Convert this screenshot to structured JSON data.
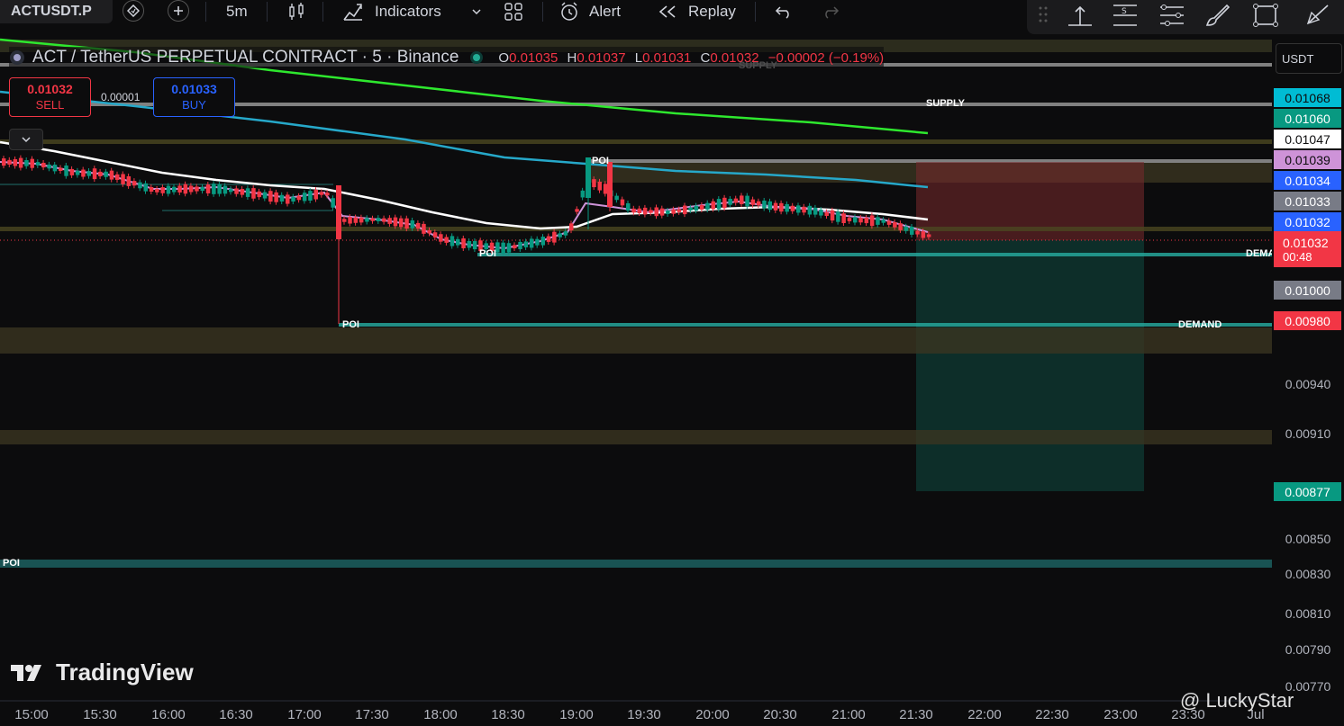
{
  "toolbar": {
    "symbol": "ACTUSDT.P",
    "interval": "5m",
    "indicators_label": "Indicators",
    "alert_label": "Alert",
    "replay_label": "Replay"
  },
  "legend": {
    "title": "ACT / TetherUS PERPETUAL CONTRACT · 5 · Binance",
    "o_label": "O",
    "o_value": "0.01035",
    "h_label": "H",
    "h_value": "0.01037",
    "l_label": "L",
    "l_value": "0.01031",
    "c_label": "C",
    "c_value": "0.01032",
    "change": "−0.00002 (−0.19%)"
  },
  "trade": {
    "sell_price": "0.01032",
    "sell_label": "SELL",
    "buy_price": "0.01033",
    "buy_label": "BUY",
    "spread": "0.00001"
  },
  "axis": {
    "currency": "USDT",
    "price_ticks": [
      "0.00940",
      "0.00910",
      "0.00850",
      "0.00830",
      "0.00810",
      "0.00790",
      "0.00770"
    ],
    "labels": [
      {
        "text": "0.01068",
        "bg": "#00bcd4",
        "fg": "#0c0c0d"
      },
      {
        "text": "0.01060",
        "bg": "#089981",
        "fg": "#ffffff"
      },
      {
        "text": "0.01047",
        "bg": "#ffffff",
        "fg": "#0c0c0d"
      },
      {
        "text": "0.01039",
        "bg": "#ce93d8",
        "fg": "#0c0c0d"
      },
      {
        "text": "0.01034",
        "bg": "#2962ff",
        "fg": "#ffffff"
      },
      {
        "text": "0.01033",
        "bg": "#787b86",
        "fg": "#ffffff"
      },
      {
        "text": "0.01032",
        "bg": "#2962ff",
        "fg": "#ffffff"
      },
      {
        "text": "0.01032",
        "bg": "#f23645",
        "fg": "#ffffff"
      },
      {
        "text": "0.01000",
        "bg": "#787b86",
        "fg": "#ffffff"
      },
      {
        "text": "0.00980",
        "bg": "#f23645",
        "fg": "#ffffff"
      },
      {
        "text": "0.00877",
        "bg": "#089981",
        "fg": "#ffffff"
      }
    ],
    "countdown": "00:48",
    "time_ticks": [
      "15:00",
      "15:30",
      "16:00",
      "16:30",
      "17:00",
      "17:30",
      "18:00",
      "18:30",
      "19:00",
      "19:30",
      "20:00",
      "20:30",
      "21:00",
      "21:30",
      "22:00",
      "22:30",
      "23:00",
      "23:30",
      "Jul"
    ]
  },
  "zones": {
    "supply_1": "SUPPLY",
    "supply_2": "SUPPLY",
    "demand_1": "DEMAND",
    "demand_2": "DEMA",
    "poi_1": "POI",
    "poi_2": "POI",
    "poi_3": "POI",
    "poi_4": "POI"
  },
  "branding": {
    "logo_text": "TradingView",
    "watermark": "@ LuckyStar"
  },
  "colors": {
    "up": "#089981",
    "down": "#f23645",
    "ema_white": "#ffffff",
    "ema_cyan": "#26a8c9",
    "ema_green": "#2ee82e",
    "ema_purple": "#ce93d8"
  }
}
